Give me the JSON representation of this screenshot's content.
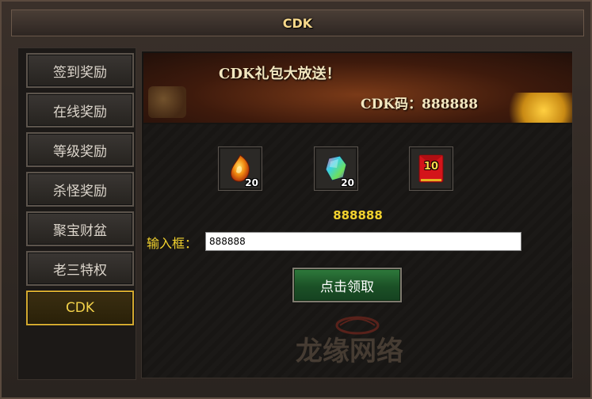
{
  "window": {
    "title": "CDK"
  },
  "sidebar": {
    "items": [
      {
        "label": "签到奖励"
      },
      {
        "label": "在线奖励"
      },
      {
        "label": "等级奖励"
      },
      {
        "label": "杀怪奖励"
      },
      {
        "label": "聚宝财盆"
      },
      {
        "label": "老三特权"
      },
      {
        "label": "CDK"
      }
    ],
    "active_index": 6
  },
  "banner": {
    "title": "CDK礼包大放送！",
    "code_text": "CDK码：888888"
  },
  "rewards": [
    {
      "icon": "fire-gem-icon",
      "count": "20"
    },
    {
      "icon": "rainbow-crystal-icon",
      "count": "20"
    },
    {
      "icon": "red-envelope-icon",
      "count": "10"
    }
  ],
  "code_display": "888888",
  "input": {
    "label": "输入框：",
    "value": "888888"
  },
  "claim_button": {
    "label": "点击领取"
  },
  "watermark": {
    "text": "龙缘网络"
  },
  "colors": {
    "accent": "#f2d22e",
    "active_border": "#d2a82e",
    "claim_green": "#1b5026"
  }
}
